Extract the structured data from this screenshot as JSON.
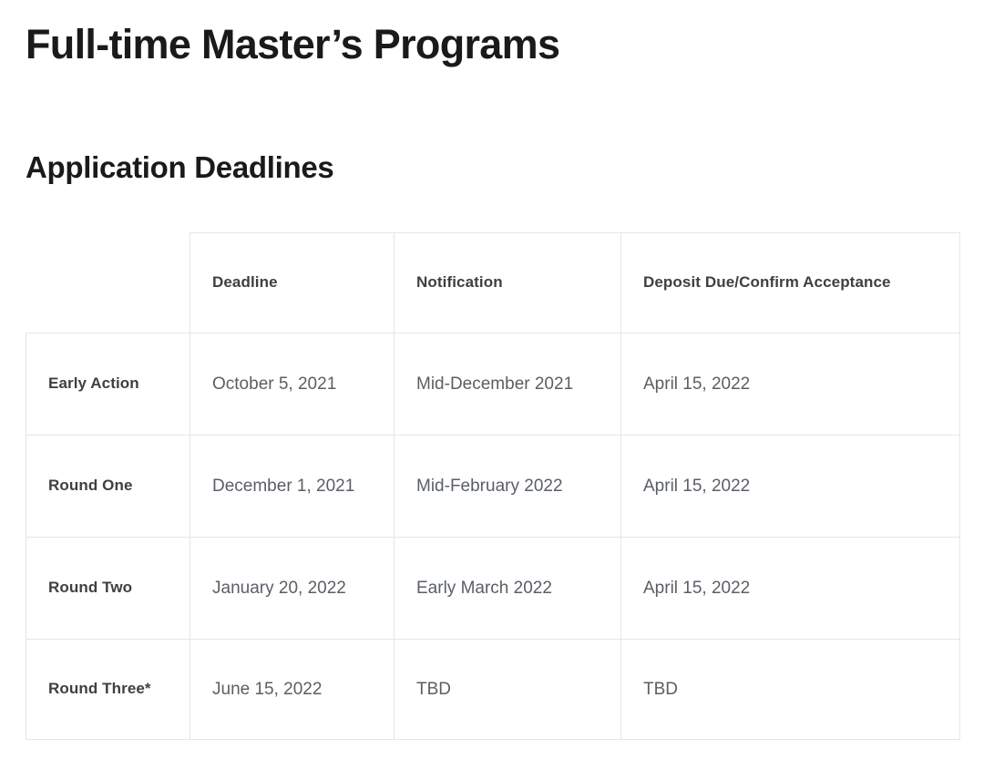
{
  "page": {
    "title": "Full-time Master’s Programs",
    "section_title": "Application Deadlines"
  },
  "table": {
    "name": "application-deadlines-table",
    "columns": [
      {
        "key": "program",
        "label": ""
      },
      {
        "key": "deadline",
        "label": "Deadline"
      },
      {
        "key": "notification",
        "label": "Notification"
      },
      {
        "key": "deposit",
        "label": "Deposit Due/Confirm Acceptance"
      }
    ],
    "rows": [
      {
        "program": "Early Action",
        "deadline": "October 5, 2021",
        "notification": "Mid-December 2021",
        "deposit": "April 15, 2022"
      },
      {
        "program": "Round One",
        "deadline": "December 1, 2021",
        "notification": "Mid-February 2022",
        "deposit": "April 15, 2022"
      },
      {
        "program": "Round Two",
        "deadline": "January 20, 2022",
        "notification": "Early March 2022",
        "deposit": "April 15, 2022"
      },
      {
        "program": "Round Three*",
        "deadline": "June 15, 2022",
        "notification": "TBD",
        "deposit": "TBD"
      }
    ]
  },
  "colors": {
    "background": "#ffffff",
    "heading_text": "#1a1a1a",
    "table_header_text": "#3d4043",
    "table_body_text": "#5a5f66",
    "border": "#e6e6e6"
  }
}
